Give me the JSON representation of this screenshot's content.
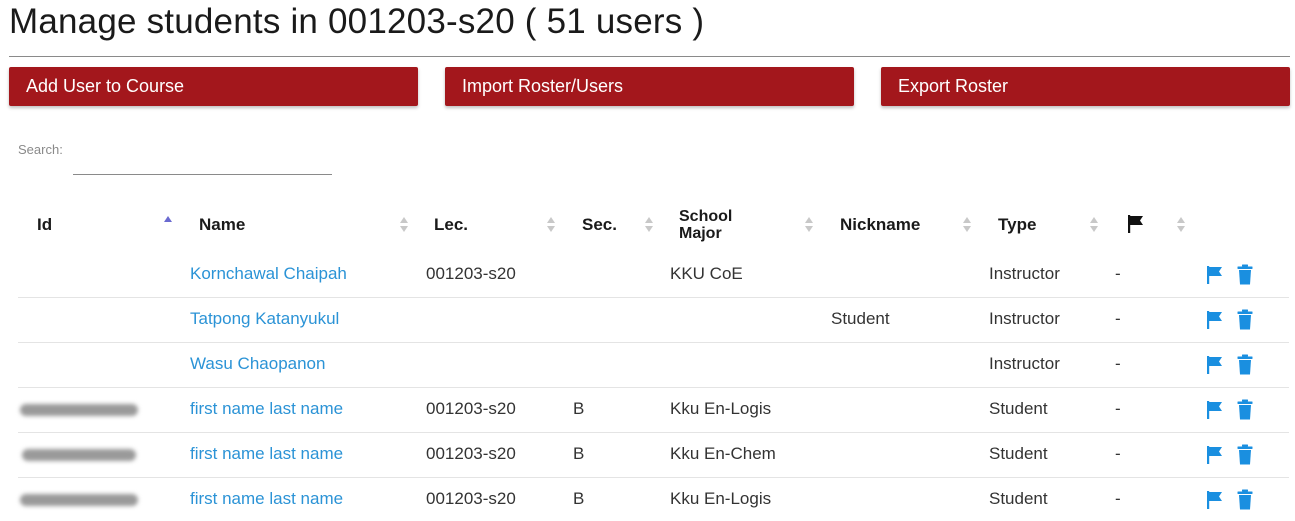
{
  "page_title": "Manage students in 001203-s20 ( 51 users )",
  "actions": {
    "add_user": "Add User to Course",
    "import_roster": "Import Roster/Users",
    "export_roster": "Export Roster"
  },
  "search": {
    "label": "Search:",
    "value": ""
  },
  "columns": {
    "id": "Id",
    "name": "Name",
    "lec": "Lec.",
    "sec": "Sec.",
    "school": "School",
    "major": "Major",
    "nickname": "Nickname",
    "type": "Type"
  },
  "sort": {
    "column": "id",
    "direction": "ascending"
  },
  "colors": {
    "button_bg": "#a3171c",
    "link": "#2b93d6",
    "icon": "#1a8fe0"
  },
  "rows": [
    {
      "id": "",
      "name": "Kornchawal Chaipah",
      "lec": "001203-s20",
      "sec": "",
      "school_major": "KKU CoE",
      "nickname": "",
      "type": "Instructor",
      "flag": "-"
    },
    {
      "id": "",
      "name": "Tatpong Katanyukul",
      "lec": "",
      "sec": "",
      "school_major": "",
      "nickname": "Student",
      "type": "Instructor",
      "flag": "-"
    },
    {
      "id": "",
      "name": "Wasu Chaopanon",
      "lec": "",
      "sec": "",
      "school_major": "",
      "nickname": "",
      "type": "Instructor",
      "flag": "-"
    },
    {
      "id": "",
      "name": "first name last name",
      "lec": "001203-s20",
      "sec": "B",
      "school_major": "Kku En-Logis",
      "nickname": "",
      "type": "Student",
      "flag": "-"
    },
    {
      "id": "",
      "name": "first name last name",
      "lec": "001203-s20",
      "sec": "B",
      "school_major": "Kku En-Chem",
      "nickname": "",
      "type": "Student",
      "flag": "-"
    },
    {
      "id": "",
      "name": "first name last name",
      "lec": "001203-s20",
      "sec": "B",
      "school_major": "Kku En-Logis",
      "nickname": "",
      "type": "Student",
      "flag": "-"
    }
  ],
  "icons": {
    "flag_header": "flag-icon",
    "row_flag": "flag-icon",
    "row_delete": "trash-icon"
  }
}
